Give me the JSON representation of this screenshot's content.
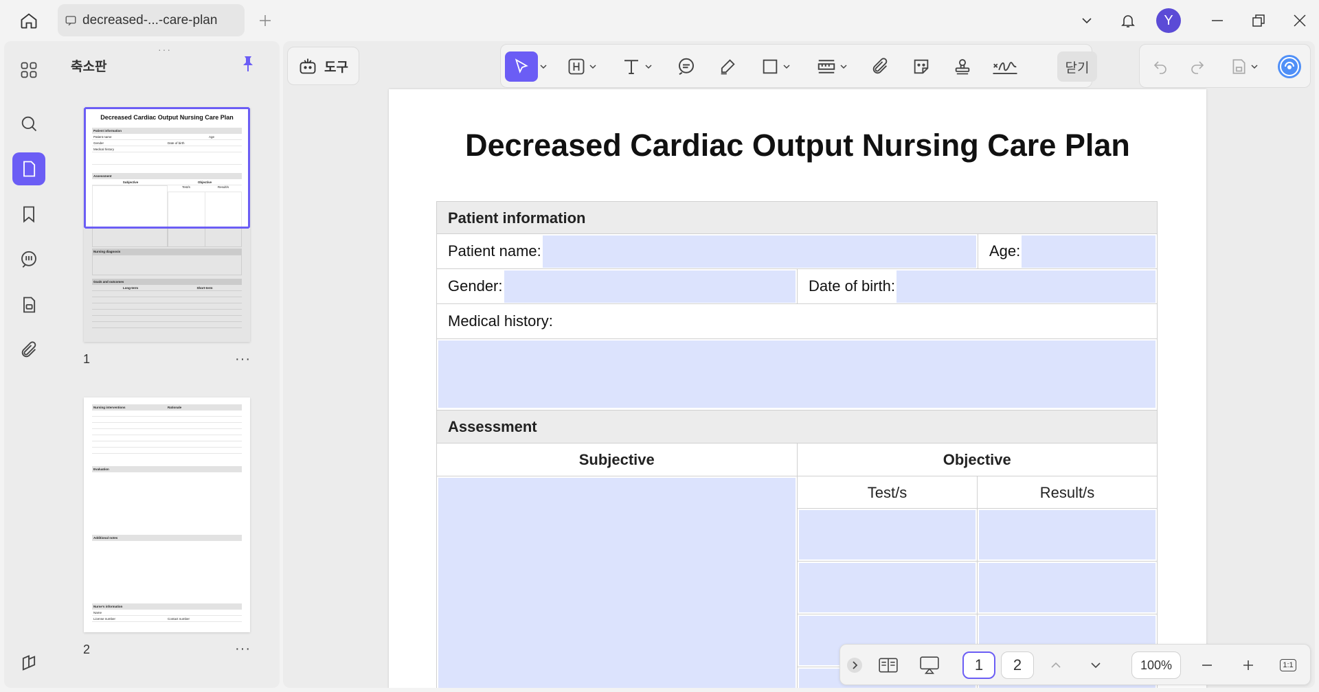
{
  "titlebar": {
    "tab_title": "decreased-...-care-plan",
    "avatar_letter": "Y"
  },
  "sidebar_rail": {
    "items": [
      "apps-icon",
      "search-icon",
      "thumbnail-icon",
      "bookmark-icon",
      "comment-icon",
      "document-icon",
      "attachment-icon",
      "layers-icon"
    ],
    "active": "thumbnail-icon"
  },
  "thumbnail_panel": {
    "title": "축소판",
    "pages": [
      {
        "number": "1",
        "more": "···"
      },
      {
        "number": "2",
        "more": "···"
      }
    ],
    "page1": {
      "title": "Decreased Cardiac Output Nursing Care Plan",
      "patient_information": "Patient information",
      "patient_name": "Patient name",
      "age": "Age",
      "gender": "Gender",
      "date_of_birth": "Date of birth",
      "medical_history": "Medical history",
      "assessment": "Assessment",
      "subjective": "Subjective",
      "objective": "Objective",
      "tests": "Test/s",
      "results": "Result/s",
      "nursing_diagnosis": "Nursing diagnosis",
      "goals": "Goals and outcomes",
      "long_term": "Long-term",
      "short_term": "Short-term"
    },
    "page2": {
      "nursing_interventions": "Nursing interventions",
      "rationale": "Rationale",
      "evaluation": "Evaluation",
      "additional_notes": "Additional notes",
      "nurse_information": "Nurse's information",
      "name": "Name",
      "license_number": "License number",
      "contact_number": "Contact number"
    }
  },
  "toolbar": {
    "tools_label": "도구",
    "close_label": "닫기"
  },
  "document": {
    "title": "Decreased Cardiac Output Nursing Care Plan",
    "patient_information": "Patient information",
    "patient_name_label": "Patient name:",
    "age_label": "Age:",
    "gender_label": "Gender:",
    "dob_label": "Date of birth:",
    "medical_history_label": "Medical history:",
    "assessment": "Assessment",
    "subjective": "Subjective",
    "objective": "Objective",
    "tests": "Test/s",
    "results": "Result/s"
  },
  "bottom_bar": {
    "current_page": "1",
    "page_2": "2",
    "zoom": "100%",
    "fit_label": "1:1"
  },
  "colors": {
    "accent": "#6b5df5",
    "field_fill": "#dce3fd",
    "avatar": "#5b4bd6"
  }
}
